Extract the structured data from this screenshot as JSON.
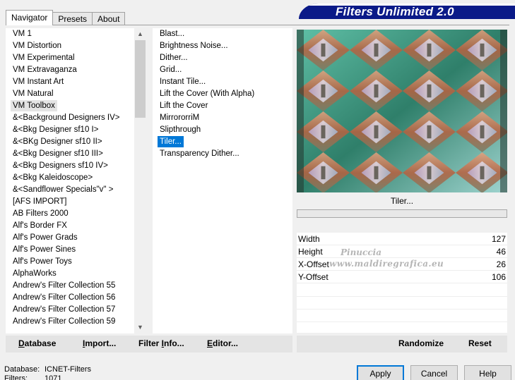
{
  "tabs": [
    {
      "label": "Navigator",
      "active": true
    },
    {
      "label": "Presets",
      "active": false
    },
    {
      "label": "About",
      "active": false
    }
  ],
  "banner": {
    "title": "Filters Unlimited 2.0",
    "color": "#0a1a88"
  },
  "categories": [
    "VM 1",
    "VM Distortion",
    "VM Experimental",
    "VM Extravaganza",
    "VM Instant Art",
    "VM Natural",
    "VM Toolbox",
    "&<Background Designers IV>",
    "&<Bkg Designer sf10 I>",
    "&<BKg Designer sf10 II>",
    "&<Bkg Designer sf10 III>",
    "&<Bkg Designers sf10 IV>",
    "&<Bkg Kaleidoscope>",
    "&<Sandflower Specials\"v\" >",
    "[AFS IMPORT]",
    "AB Filters 2000",
    "Alf's Border FX",
    "Alf's Power Grads",
    "Alf's Power Sines",
    "Alf's Power Toys",
    "AlphaWorks",
    "Andrew's Filter Collection 55",
    "Andrew's Filter Collection 56",
    "Andrew's Filter Collection 57",
    "Andrew's Filter Collection 59"
  ],
  "selected_category": "VM Toolbox",
  "filters": [
    "Blast...",
    "Brightness Noise...",
    "Dither...",
    "Grid...",
    "Instant Tile...",
    "Lift the Cover (With Alpha)",
    "Lift the Cover",
    "MirrororriM",
    "Slipthrough",
    "Tiler...",
    "Transparency Dither..."
  ],
  "selected_filter": "Tiler...",
  "selection_color": "#0078d7",
  "preview": {
    "caption": "Tiler..."
  },
  "params": [
    {
      "label": "Width",
      "value": "127"
    },
    {
      "label": "Height",
      "value": "46"
    },
    {
      "label": "X-Offset",
      "value": "26"
    },
    {
      "label": "Y-Offset",
      "value": "106"
    }
  ],
  "watermark": {
    "line1": "Pinuccia",
    "line2": "www.maldiregrafica.eu"
  },
  "commands_left": {
    "database": "Database",
    "import": "Import...",
    "filter_info": "Filter Info...",
    "editor": "Editor..."
  },
  "commands_right": {
    "randomize": "Randomize",
    "reset": "Reset"
  },
  "status": {
    "database_label": "Database:",
    "database_value": "ICNET-Filters",
    "filters_label": "Filters:",
    "filters_value": "1071"
  },
  "buttons": {
    "apply": "Apply",
    "cancel": "Cancel",
    "help": "Help"
  }
}
